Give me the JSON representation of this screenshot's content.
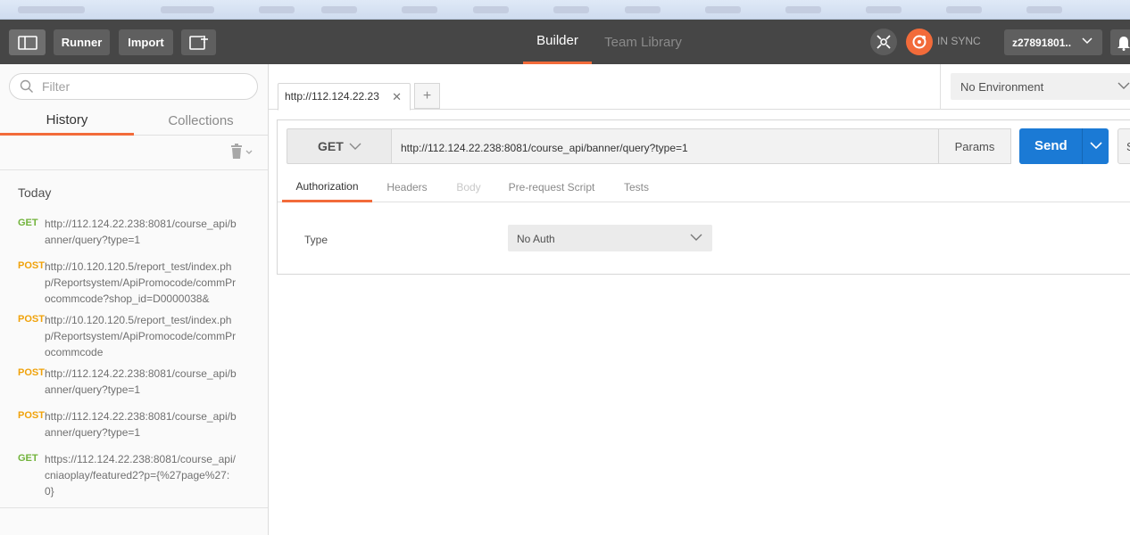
{
  "header": {
    "runner_label": "Runner",
    "import_label": "Import",
    "tabs": [
      {
        "label": "Builder",
        "active": true
      },
      {
        "label": "Team Library",
        "active": false
      }
    ],
    "sync_status": "IN SYNC",
    "username": "z27891801..",
    "colors": {
      "bar": "#464646",
      "accent": "#f26b3a"
    }
  },
  "sidebar": {
    "filter_placeholder": "Filter",
    "tabs": [
      {
        "label": "History",
        "active": true
      },
      {
        "label": "Collections",
        "active": false
      }
    ],
    "group_label": "Today",
    "history": [
      {
        "method": "GET",
        "url": "http://112.124.22.238:8081/course_api/banner/query?type=1"
      },
      {
        "method": "POST",
        "url": "http://10.120.120.5/report_test/index.php/Reportsystem/ApiPromocode/commProcommcode?shop_id=D0000038&"
      },
      {
        "method": "POST",
        "url": "http://10.120.120.5/report_test/index.php/Reportsystem/ApiPromocode/commProcommcode"
      },
      {
        "method": "POST",
        "url": "http://112.124.22.238:8081/course_api/banner/query?type=1"
      },
      {
        "method": "POST",
        "url": "http://112.124.22.238:8081/course_api/banner/query?type=1"
      },
      {
        "method": "GET",
        "url": "https://112.124.22.238:8081/course_api/cniaoplay/featured2?p={%27page%27:0}"
      }
    ],
    "method_colors": {
      "GET": "#71b33b",
      "POST": "#f0a20a"
    }
  },
  "main": {
    "open_tab_label": "http://112.124.22.23",
    "add_tab_label": "+",
    "environment": "No Environment",
    "request": {
      "method": "GET",
      "url": "http://112.124.22.238:8081/course_api/banner/query?type=1",
      "params_label": "Params",
      "send_label": "Send",
      "save_label": "S",
      "send_color": "#1b7ad5"
    },
    "request_tabs": [
      {
        "label": "Authorization",
        "active": true
      },
      {
        "label": "Headers",
        "active": false
      },
      {
        "label": "Body",
        "active": false,
        "disabled": true
      },
      {
        "label": "Pre-request Script",
        "active": false
      },
      {
        "label": "Tests",
        "active": false
      }
    ],
    "auth": {
      "type_label": "Type",
      "type_value": "No Auth"
    }
  }
}
